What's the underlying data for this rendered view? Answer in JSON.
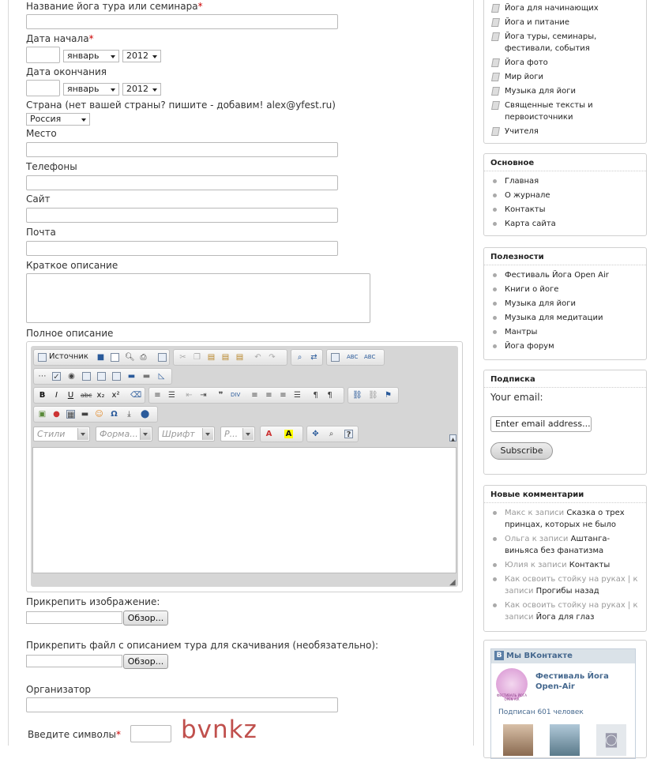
{
  "form": {
    "name_label": "Название йога тура или семинара",
    "start_label": "Дата начала",
    "end_label": "Дата окончания",
    "country_label": "Страна (нет вашей страны? пишите - добавим! alex@yfest.ru)",
    "place_label": "Место",
    "phones_label": "Телефоны",
    "site_label": "Сайт",
    "mail_label": "Почта",
    "short_label": "Краткое описание",
    "full_label": "Полное описание",
    "month_value": "январь",
    "year_value": "2012",
    "country_value": "Россия",
    "attach_image_label": "Прикрепить изображение:",
    "attach_file_label": "Прикрепить файл с описанием тура для скачивания (необязательно):",
    "browse_label": "Обзор...",
    "organizer_label": "Организатор",
    "captcha_label": "Введите символы",
    "captcha_text": "bvnkz",
    "required_mark": "*"
  },
  "editor": {
    "source_label": "Источник",
    "styles_placeholder": "Стили",
    "format_placeholder": "Форма...",
    "font_placeholder": "Шрифт",
    "size_placeholder": "Р..."
  },
  "sidebar": {
    "categories": [
      "Йога для начинающих",
      "Йога и питание",
      "Йога туры, семинары, фестивали, события",
      "Йога фото",
      "Мир йоги",
      "Музыка для йоги",
      "Священные тексты и первоисточники",
      "Учителя"
    ],
    "basic_title": "Основное",
    "basic_items": [
      "Главная",
      "О журнале",
      "Контакты",
      "Карта сайта"
    ],
    "useful_title": "Полезности",
    "useful_items": [
      "Фестиваль Йога Open Air",
      "Книги о йоге",
      "Музыка для йоги",
      "Музыка для медитации",
      "Мантры",
      "Йога форум"
    ],
    "subscribe_title": "Подписка",
    "your_email_label": "Your email:",
    "email_value": "Enter email address...",
    "subscribe_button": "Subscribe",
    "comments_title": "Новые комментарии",
    "comments": [
      {
        "who": "Макс к записи",
        "post": "Сказка о трех принцах, которых не было"
      },
      {
        "who": "Ольга к записи",
        "post": "Аштанга-виньяса без фанатизма"
      },
      {
        "who": "Юлия к записи",
        "post": "Контакты"
      },
      {
        "who": "Как освоить стойку на руках | к записи",
        "post": "Прогибы назад"
      },
      {
        "who": "Как освоить стойку на руках | к записи",
        "post": "Йога для глаз"
      }
    ],
    "vk_title": "Мы ВКонтакте",
    "vk_group": "Фестиваль Йога Open-Air",
    "vk_logo_text": "ФЕСТИВАЛЬ ЙОГА OPEN AIR",
    "vk_subscribers": "Подписан 601 человек"
  },
  "colors": {
    "required": "#cc0000",
    "captcha": "#c0504d",
    "vk_blue": "#45688e"
  }
}
